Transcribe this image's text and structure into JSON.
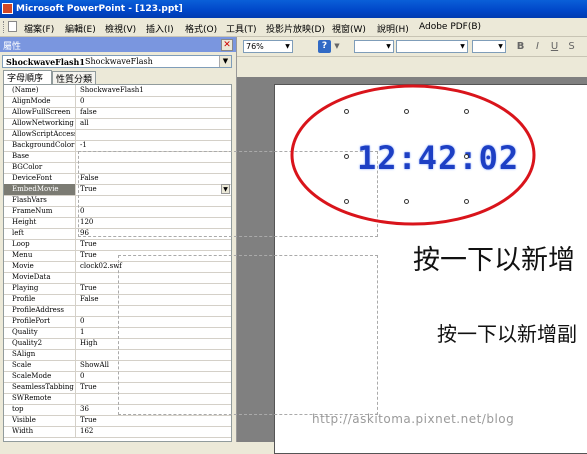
{
  "window": {
    "title": "Microsoft PowerPoint - [123.ppt]"
  },
  "menu": [
    "檔案(F)",
    "編輯(E)",
    "檢視(V)",
    "插入(I)",
    "格式(O)",
    "工具(T)",
    "投影片放映(D)",
    "視窗(W)",
    "說明(H)",
    "Adobe PDF(B)"
  ],
  "properties_panel": {
    "title": "屬性",
    "close_glyph": "✕",
    "object_name": "ShockwaveFlash1",
    "object_type": "ShockwaveFlash",
    "tabs": [
      "字母順序",
      "性質分類"
    ],
    "rows": [
      {
        "name": "(Name)",
        "value": "ShockwaveFlash1"
      },
      {
        "name": "AlignMode",
        "value": "0"
      },
      {
        "name": "AllowFullScreen",
        "value": "false"
      },
      {
        "name": "AllowNetworking",
        "value": "all"
      },
      {
        "name": "AllowScriptAccess",
        "value": ""
      },
      {
        "name": "BackgroundColor",
        "value": "-1"
      },
      {
        "name": "Base",
        "value": ""
      },
      {
        "name": "BGColor",
        "value": ""
      },
      {
        "name": "DeviceFont",
        "value": "False"
      },
      {
        "name": "EmbedMovie",
        "value": "True"
      },
      {
        "name": "FlashVars",
        "value": ""
      },
      {
        "name": "FrameNum",
        "value": "0"
      },
      {
        "name": "Height",
        "value": "120"
      },
      {
        "name": "left",
        "value": "96"
      },
      {
        "name": "Loop",
        "value": "True"
      },
      {
        "name": "Menu",
        "value": "True"
      },
      {
        "name": "Movie",
        "value": "clock02.swf"
      },
      {
        "name": "MovieData",
        "value": ""
      },
      {
        "name": "Playing",
        "value": "True"
      },
      {
        "name": "Profile",
        "value": "False"
      },
      {
        "name": "ProfileAddress",
        "value": ""
      },
      {
        "name": "ProfilePort",
        "value": "0"
      },
      {
        "name": "Quality",
        "value": "1"
      },
      {
        "name": "Quality2",
        "value": "High"
      },
      {
        "name": "SAlign",
        "value": ""
      },
      {
        "name": "Scale",
        "value": "ShowAll"
      },
      {
        "name": "ScaleMode",
        "value": "0"
      },
      {
        "name": "SeamlessTabbing",
        "value": "True"
      },
      {
        "name": "SWRemote",
        "value": ""
      },
      {
        "name": "top",
        "value": "36"
      },
      {
        "name": "Visible",
        "value": "True"
      },
      {
        "name": "Width",
        "value": "162"
      }
    ],
    "selected_row": "EmbedMovie"
  },
  "toolbar": {
    "zoom": "76%",
    "font": "",
    "font_size": "",
    "buttons": [
      "B",
      "I",
      "U",
      "S"
    ]
  },
  "slide": {
    "clock_text": "12:42:02",
    "title_placeholder": "按一下以新增",
    "body_placeholder": "按一下以新增副"
  },
  "watermark": "http://askitoma.pixnet.net/blog",
  "colors": {
    "title_bar": "#0046c8",
    "highlight_ring": "#d9141b",
    "clock": "#1d3fc4"
  }
}
